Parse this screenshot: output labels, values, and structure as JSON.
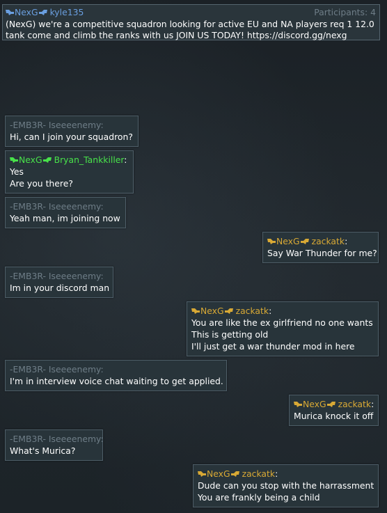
{
  "window": {
    "participants_label": "Participants: 4"
  },
  "icons": {
    "clan_left": "nexg-clan-left-icon",
    "clan_right": "nexg-clan-right-icon"
  },
  "header": {
    "clan_tag": "NexG",
    "username": "kyle135",
    "message": "(NexG) we're a competitive squadron looking for active EU and NA players req 1 12.0 tank come and climb the ranks with us JOIN US TODAY! https://discord.gg/nexg"
  },
  "colors": {
    "clan_tag_blue": "#6a9fe0",
    "clan_tag_gold": "#d8a935",
    "clan_tag_green": "#48e24a",
    "muted_name": "#6e7d87",
    "bubble_background": "#28343a",
    "bubble_border": "#4e5e68"
  },
  "messages": [
    {
      "sender": "-EMB3R- Iseeeenemy",
      "lines": [
        "Hi, can I join your squadron?"
      ]
    },
    {
      "clan_tag": "NexG",
      "sender": "Bryan_Tankkiller",
      "lines": [
        "Yes",
        "Are you there?"
      ]
    },
    {
      "sender": "-EMB3R- Iseeeenemy",
      "lines": [
        "Yeah man, im joining now"
      ]
    },
    {
      "clan_tag": "NexG",
      "sender": "zackatk",
      "lines": [
        "Say War Thunder for me?"
      ]
    },
    {
      "sender": "-EMB3R- Iseeeenemy",
      "lines": [
        "Im in your discord man"
      ]
    },
    {
      "clan_tag": "NexG",
      "sender": "zackatk",
      "lines": [
        "You are like the ex girlfriend no one wants",
        "This is getting old",
        "I'll just get a war thunder mod in here"
      ]
    },
    {
      "sender": "-EMB3R- Iseeeenemy",
      "lines": [
        "I'm in interview voice chat waiting to get applied."
      ]
    },
    {
      "clan_tag": "NexG",
      "sender": "zackatk",
      "lines": [
        "Murica knock it off"
      ]
    },
    {
      "sender": "-EMB3R- Iseeeenemy",
      "lines": [
        "What's Murica?"
      ]
    },
    {
      "clan_tag": "NexG",
      "sender": "zackatk",
      "lines": [
        "Dude can you stop with the harrassment",
        "You are frankly being a child"
      ]
    }
  ]
}
